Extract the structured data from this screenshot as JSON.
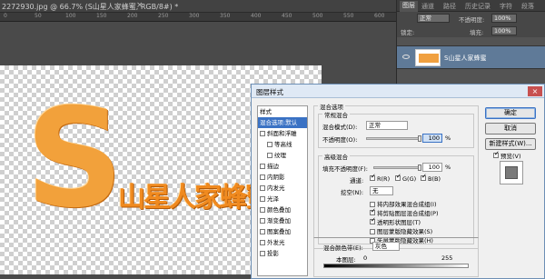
{
  "document": {
    "tab_title": "2272930.jpg @ 66.7% (S山星人家蜂蜜, RGB/8#) *",
    "close": "×"
  },
  "ruler": {
    "marks": [
      "0",
      "50",
      "100",
      "150",
      "200",
      "250",
      "300",
      "350",
      "400",
      "450",
      "500",
      "550",
      "600"
    ]
  },
  "artwork": {
    "big_letter": "S",
    "text": "山星人家蜂蜜"
  },
  "layers_panel": {
    "tabs": [
      "图层",
      "通道",
      "路径",
      "历史记录",
      "字符",
      "段落"
    ],
    "blend_mode": "正常",
    "opacity_label": "不透明度:",
    "opacity": "100%",
    "lock_label": "锁定:",
    "fill_label": "填充:",
    "fill": "100%",
    "layer_name": "S山星人家蜂蜜"
  },
  "dialog": {
    "title": "图层样式",
    "close": "×",
    "styles": [
      {
        "label": "样式",
        "check": false,
        "selected": false,
        "head": true
      },
      {
        "label": "混合选项:默认",
        "check": false,
        "selected": true,
        "head": true
      },
      {
        "label": "斜面和浮雕",
        "check": true,
        "on": false
      },
      {
        "label": "等高线",
        "check": true,
        "on": false,
        "indent": true
      },
      {
        "label": "纹理",
        "check": true,
        "on": false,
        "indent": true
      },
      {
        "label": "描边",
        "check": true,
        "on": false
      },
      {
        "label": "内阴影",
        "check": true,
        "on": false
      },
      {
        "label": "内发光",
        "check": true,
        "on": false
      },
      {
        "label": "光泽",
        "check": true,
        "on": false
      },
      {
        "label": "颜色叠加",
        "check": true,
        "on": false
      },
      {
        "label": "渐变叠加",
        "check": true,
        "on": false
      },
      {
        "label": "图案叠加",
        "check": true,
        "on": false
      },
      {
        "label": "外发光",
        "check": true,
        "on": false
      },
      {
        "label": "投影",
        "check": true,
        "on": false
      }
    ],
    "blend_options_title": "混合选项",
    "general_title": "常规混合",
    "blend_mode_label": "混合模式(D):",
    "blend_mode": "正常",
    "opacity_label": "不透明度(O):",
    "opacity": "100",
    "opacity_unit": "%",
    "advanced_title": "高级混合",
    "fill_label": "填充不透明度(F):",
    "fill": "100",
    "fill_unit": "%",
    "channels_label": "通道:",
    "ch_r": "R(R)",
    "ch_g": "G(G)",
    "ch_b": "B(B)",
    "knockout_label": "挖空(N):",
    "knockout": "无",
    "opts": [
      {
        "label": "将内部效果混合成组(I)",
        "on": false
      },
      {
        "label": "将剪贴图层混合成组(P)",
        "on": true
      },
      {
        "label": "透明形状图层(T)",
        "on": true
      },
      {
        "label": "图层蒙版隐藏效果(S)",
        "on": false
      },
      {
        "label": "矢量蒙版隐藏效果(H)",
        "on": false
      }
    ],
    "blend_if_label": "混合颜色带(E):",
    "blend_if": "灰色",
    "this_layer_label": "本图层:",
    "this_layer_lo": "0",
    "this_layer_hi": "255",
    "ok": "确定",
    "cancel": "取消",
    "new_style": "新建样式(W)...",
    "preview_label": "预览(V)",
    "preview_on": true
  }
}
